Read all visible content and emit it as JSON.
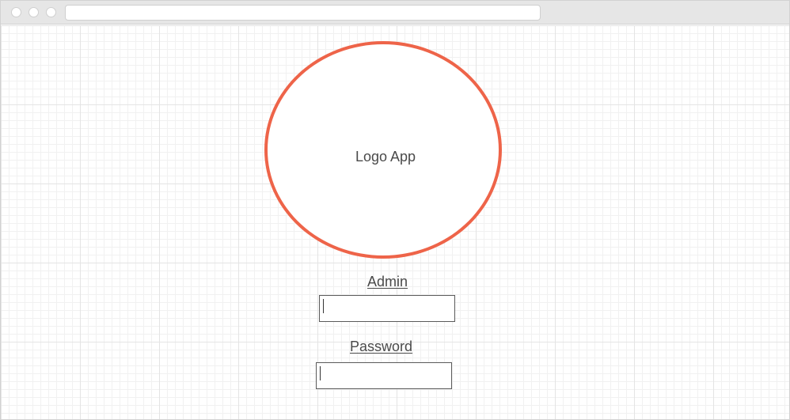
{
  "window": {
    "address_bar_text": ""
  },
  "logo": {
    "label": "Logo App",
    "border_color": "#ee6449"
  },
  "login_form": {
    "admin_label": "Admin",
    "admin_value": "",
    "password_label": "Password",
    "password_value": ""
  }
}
